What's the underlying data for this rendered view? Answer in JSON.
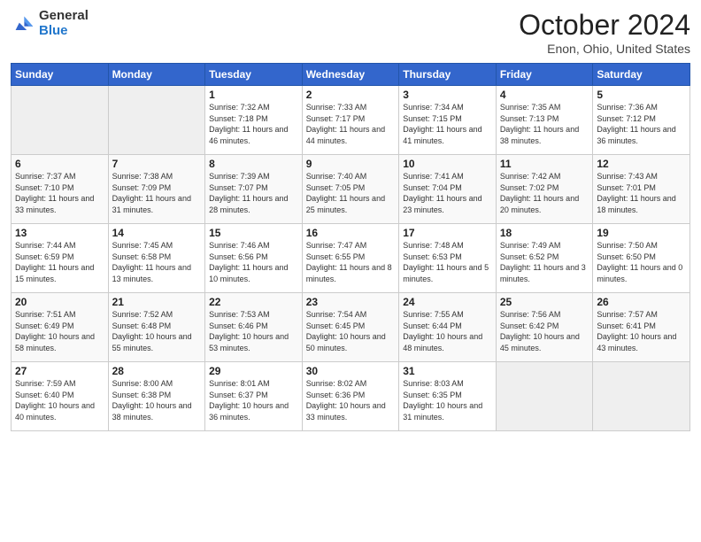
{
  "header": {
    "logo_general": "General",
    "logo_blue": "Blue",
    "month_title": "October 2024",
    "location": "Enon, Ohio, United States"
  },
  "days_of_week": [
    "Sunday",
    "Monday",
    "Tuesday",
    "Wednesday",
    "Thursday",
    "Friday",
    "Saturday"
  ],
  "weeks": [
    [
      {
        "day": "",
        "empty": true
      },
      {
        "day": "",
        "empty": true
      },
      {
        "day": "1",
        "sunrise": "7:32 AM",
        "sunset": "7:18 PM",
        "daylight": "11 hours and 46 minutes."
      },
      {
        "day": "2",
        "sunrise": "7:33 AM",
        "sunset": "7:17 PM",
        "daylight": "11 hours and 44 minutes."
      },
      {
        "day": "3",
        "sunrise": "7:34 AM",
        "sunset": "7:15 PM",
        "daylight": "11 hours and 41 minutes."
      },
      {
        "day": "4",
        "sunrise": "7:35 AM",
        "sunset": "7:13 PM",
        "daylight": "11 hours and 38 minutes."
      },
      {
        "day": "5",
        "sunrise": "7:36 AM",
        "sunset": "7:12 PM",
        "daylight": "11 hours and 36 minutes."
      }
    ],
    [
      {
        "day": "6",
        "sunrise": "7:37 AM",
        "sunset": "7:10 PM",
        "daylight": "11 hours and 33 minutes."
      },
      {
        "day": "7",
        "sunrise": "7:38 AM",
        "sunset": "7:09 PM",
        "daylight": "11 hours and 31 minutes."
      },
      {
        "day": "8",
        "sunrise": "7:39 AM",
        "sunset": "7:07 PM",
        "daylight": "11 hours and 28 minutes."
      },
      {
        "day": "9",
        "sunrise": "7:40 AM",
        "sunset": "7:05 PM",
        "daylight": "11 hours and 25 minutes."
      },
      {
        "day": "10",
        "sunrise": "7:41 AM",
        "sunset": "7:04 PM",
        "daylight": "11 hours and 23 minutes."
      },
      {
        "day": "11",
        "sunrise": "7:42 AM",
        "sunset": "7:02 PM",
        "daylight": "11 hours and 20 minutes."
      },
      {
        "day": "12",
        "sunrise": "7:43 AM",
        "sunset": "7:01 PM",
        "daylight": "11 hours and 18 minutes."
      }
    ],
    [
      {
        "day": "13",
        "sunrise": "7:44 AM",
        "sunset": "6:59 PM",
        "daylight": "11 hours and 15 minutes."
      },
      {
        "day": "14",
        "sunrise": "7:45 AM",
        "sunset": "6:58 PM",
        "daylight": "11 hours and 13 minutes."
      },
      {
        "day": "15",
        "sunrise": "7:46 AM",
        "sunset": "6:56 PM",
        "daylight": "11 hours and 10 minutes."
      },
      {
        "day": "16",
        "sunrise": "7:47 AM",
        "sunset": "6:55 PM",
        "daylight": "11 hours and 8 minutes."
      },
      {
        "day": "17",
        "sunrise": "7:48 AM",
        "sunset": "6:53 PM",
        "daylight": "11 hours and 5 minutes."
      },
      {
        "day": "18",
        "sunrise": "7:49 AM",
        "sunset": "6:52 PM",
        "daylight": "11 hours and 3 minutes."
      },
      {
        "day": "19",
        "sunrise": "7:50 AM",
        "sunset": "6:50 PM",
        "daylight": "11 hours and 0 minutes."
      }
    ],
    [
      {
        "day": "20",
        "sunrise": "7:51 AM",
        "sunset": "6:49 PM",
        "daylight": "10 hours and 58 minutes."
      },
      {
        "day": "21",
        "sunrise": "7:52 AM",
        "sunset": "6:48 PM",
        "daylight": "10 hours and 55 minutes."
      },
      {
        "day": "22",
        "sunrise": "7:53 AM",
        "sunset": "6:46 PM",
        "daylight": "10 hours and 53 minutes."
      },
      {
        "day": "23",
        "sunrise": "7:54 AM",
        "sunset": "6:45 PM",
        "daylight": "10 hours and 50 minutes."
      },
      {
        "day": "24",
        "sunrise": "7:55 AM",
        "sunset": "6:44 PM",
        "daylight": "10 hours and 48 minutes."
      },
      {
        "day": "25",
        "sunrise": "7:56 AM",
        "sunset": "6:42 PM",
        "daylight": "10 hours and 45 minutes."
      },
      {
        "day": "26",
        "sunrise": "7:57 AM",
        "sunset": "6:41 PM",
        "daylight": "10 hours and 43 minutes."
      }
    ],
    [
      {
        "day": "27",
        "sunrise": "7:59 AM",
        "sunset": "6:40 PM",
        "daylight": "10 hours and 40 minutes."
      },
      {
        "day": "28",
        "sunrise": "8:00 AM",
        "sunset": "6:38 PM",
        "daylight": "10 hours and 38 minutes."
      },
      {
        "day": "29",
        "sunrise": "8:01 AM",
        "sunset": "6:37 PM",
        "daylight": "10 hours and 36 minutes."
      },
      {
        "day": "30",
        "sunrise": "8:02 AM",
        "sunset": "6:36 PM",
        "daylight": "10 hours and 33 minutes."
      },
      {
        "day": "31",
        "sunrise": "8:03 AM",
        "sunset": "6:35 PM",
        "daylight": "10 hours and 31 minutes."
      },
      {
        "day": "",
        "empty": true
      },
      {
        "day": "",
        "empty": true
      }
    ]
  ]
}
